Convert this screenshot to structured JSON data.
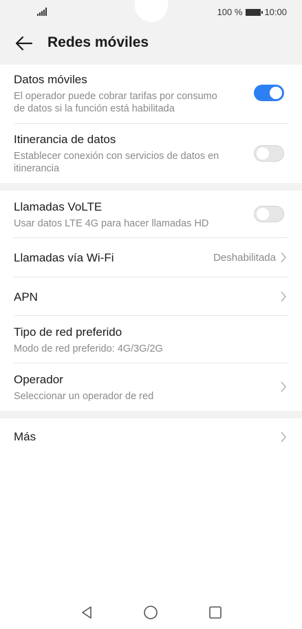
{
  "status_bar": {
    "battery_percent": "100 %",
    "time": "10:00"
  },
  "header": {
    "title": "Redes móviles"
  },
  "colors": {
    "accent": "#2d7ff4",
    "header_bg": "#f2f2f2",
    "secondary_text": "#8a8a8a"
  },
  "settings": {
    "datos_moviles": {
      "label": "Datos móviles",
      "sub_line1": "El operador puede cobrar tarifas por consumo",
      "sub_line2": "de datos si la función está habilitada",
      "enabled": true
    },
    "itinerancia": {
      "label": "Itinerancia de datos",
      "sub_line1": "Establecer conexión con servicios de datos en",
      "sub_line2": "itinerancia",
      "enabled": false
    },
    "volte": {
      "label": "Llamadas VoLTE",
      "sub": "Usar datos LTE 4G para hacer llamadas HD",
      "enabled": false
    },
    "wifi_calling": {
      "label": "Llamadas vía Wi-Fi",
      "value": "Deshabilitada"
    },
    "apn": {
      "label": "APN"
    },
    "tipo_red": {
      "label": "Tipo de red preferido",
      "sub": "Modo de red preferido: 4G/3G/2G"
    },
    "operador": {
      "label": "Operador",
      "sub": "Seleccionar un operador de red"
    },
    "mas": {
      "label": "Más"
    }
  }
}
